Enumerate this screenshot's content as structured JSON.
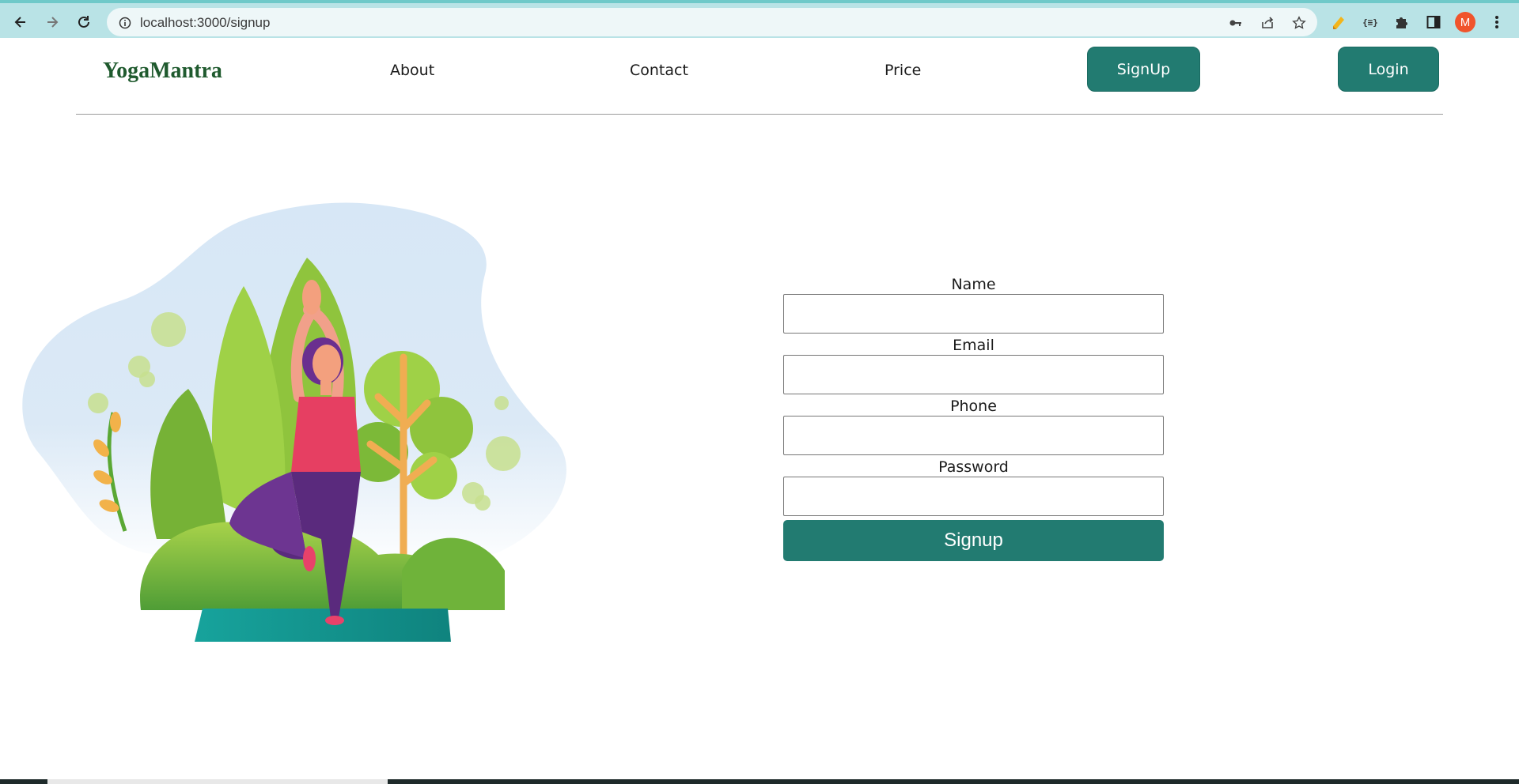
{
  "browser": {
    "url": "localhost:3000/signup",
    "profile_initial": "M",
    "icons": [
      "back-icon",
      "forward-icon",
      "reload-icon",
      "site-info-icon",
      "key-icon",
      "share-icon",
      "star-icon",
      "pencil-extension-icon",
      "json-extension-icon",
      "puzzle-icon",
      "side-panel-icon",
      "menu-icon"
    ]
  },
  "header": {
    "brand": "YogaMantra",
    "nav": {
      "about": "About",
      "contact": "Contact",
      "price": "Price"
    },
    "signup_label": "SignUp",
    "login_label": "Login"
  },
  "form": {
    "name_label": "Name",
    "email_label": "Email",
    "phone_label": "Phone",
    "password_label": "Password",
    "submit_label": "Signup"
  },
  "colors": {
    "accent": "#227b71",
    "brand_text": "#1f5a2e",
    "chrome": "#b9e3e6"
  }
}
